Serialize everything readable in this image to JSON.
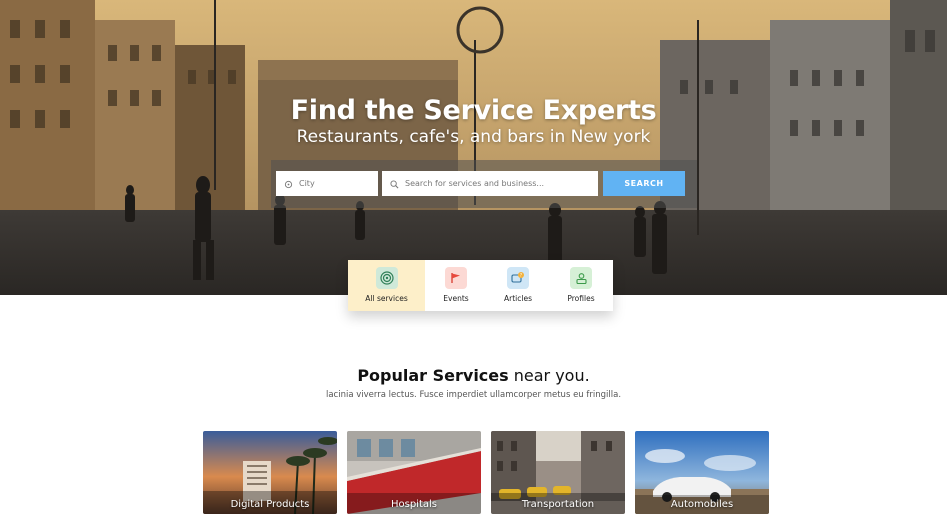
{
  "hero": {
    "title": "Find the Service Experts",
    "subtitle": "Restaurants, cafe's, and bars in New york"
  },
  "search": {
    "city_placeholder": "City",
    "service_placeholder": "Search for services and business...",
    "button_label": "SEARCH",
    "button_color": "#61b3f3"
  },
  "categories": [
    {
      "label": "All services",
      "icon": "target-icon",
      "active": true
    },
    {
      "label": "Events",
      "icon": "flag-icon",
      "active": false
    },
    {
      "label": "Articles",
      "icon": "chat-question-icon",
      "active": false
    },
    {
      "label": "Profiles",
      "icon": "profile-icon",
      "active": false
    }
  ],
  "popular": {
    "title_bold": "Popular Services",
    "title_rest": " near you.",
    "description": "lacinia viverra lectus. Fusce imperdiet ullamcorper metus eu fringilla."
  },
  "cards": [
    {
      "label": "Digital Products"
    },
    {
      "label": "Hospitals"
    },
    {
      "label": "Transportation"
    },
    {
      "label": "Automobiles"
    }
  ],
  "colors": {
    "active_tab": "#fdefc9",
    "accent": "#61b3f3"
  }
}
